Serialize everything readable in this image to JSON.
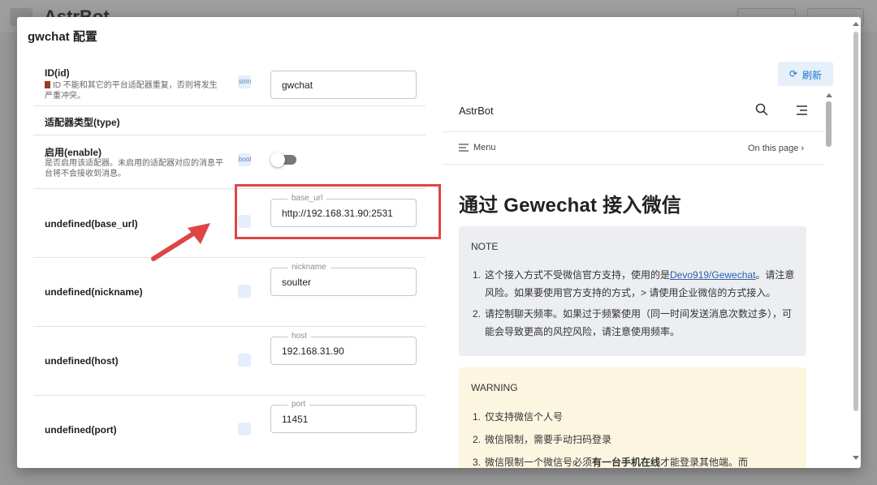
{
  "background": {
    "app_title": "AstrBot"
  },
  "dialog": {
    "title": "gwchat 配置"
  },
  "form": {
    "rows": [
      {
        "label": "ID(id)",
        "desc": "ID 不能和其它的平台适配器重复，否则将发生严重冲突。",
        "type_chip": "string",
        "value": "gwchat"
      },
      {
        "label": "适配器类型(type)"
      },
      {
        "label": "启用(enable)",
        "desc": "是否启用该适配器。未启用的适配器对应的消息平台将不会接收到消息。",
        "type_chip": "bool",
        "toggle_on": false
      },
      {
        "label": "undefined(base_url)",
        "legend": "base_url",
        "value": "http://192.168.31.90:2531"
      },
      {
        "label": "undefined(nickname)",
        "legend": "nickname",
        "value": "soulter"
      },
      {
        "label": "undefined(host)",
        "legend": "host",
        "value": "192.168.31.90"
      },
      {
        "label": "undefined(port)",
        "legend": "port",
        "value": "11451"
      }
    ]
  },
  "refresh_button": {
    "label": "刷新"
  },
  "doc": {
    "brand": "AstrBot",
    "menu_label": "Menu",
    "on_this_page": "On this page",
    "heading": "通过 Gewechat 接入微信",
    "note": {
      "title": "NOTE",
      "item1_prefix": "这个接入方式不受微信官方支持，使用的是",
      "item1_link": "Devo919/Gewechat",
      "item1_suffix": "。请注意风险。如果要使用官方支持的方式，> 请使用企业微信的方式接入。",
      "item2": "请控制聊天频率。如果过于频繁使用（同一时间发送消息次数过多），可能会导致更高的风控风险，请注意使用频率。"
    },
    "warning": {
      "title": "WARNING",
      "item1": "仅支持微信个人号",
      "item2": "微信限制，需要手动扫码登录",
      "item3_prefix": "微信限制一个微信号必须",
      "item3_bold": "有一台手机在线",
      "item3_suffix": "才能登录其他端。而"
    }
  },
  "colors": {
    "annotation_red": "#e04545",
    "link_blue": "#2b5fad",
    "note_bg": "#eceef1",
    "warning_bg": "#fcf6e1",
    "refresh_blue": "#1a73c9"
  }
}
